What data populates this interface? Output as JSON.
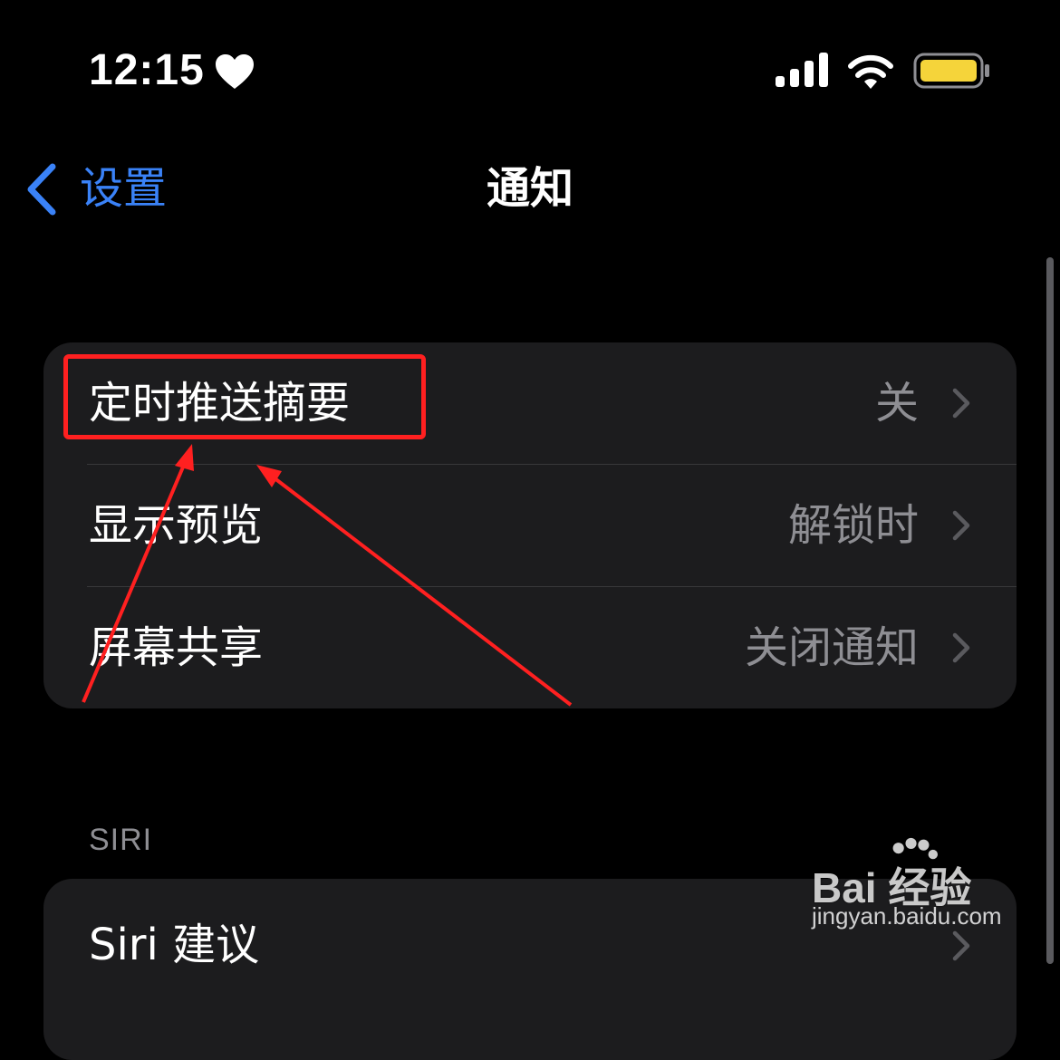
{
  "status_bar": {
    "time": "12:15",
    "icons": [
      "heart-icon",
      "cellular-signal-icon",
      "wifi-icon",
      "battery-icon"
    ],
    "battery_color": "#f5d43a"
  },
  "nav": {
    "back_label": "设置",
    "title": "通知",
    "accent_color": "#3a82f7"
  },
  "sections": [
    {
      "rows": [
        {
          "label": "定时推送摘要",
          "value": "关"
        },
        {
          "label": "显示预览",
          "value": "解锁时"
        },
        {
          "label": "屏幕共享",
          "value": "关闭通知"
        }
      ]
    },
    {
      "header": "SIRI",
      "rows": [
        {
          "label": "Siri 建议",
          "value": ""
        }
      ]
    }
  ],
  "annotation": {
    "color": "#ff2020",
    "highlighted_row": "定时推送摘要"
  },
  "watermark": {
    "brand": "Bai 经验",
    "url": "jingyan.baidu.com"
  }
}
